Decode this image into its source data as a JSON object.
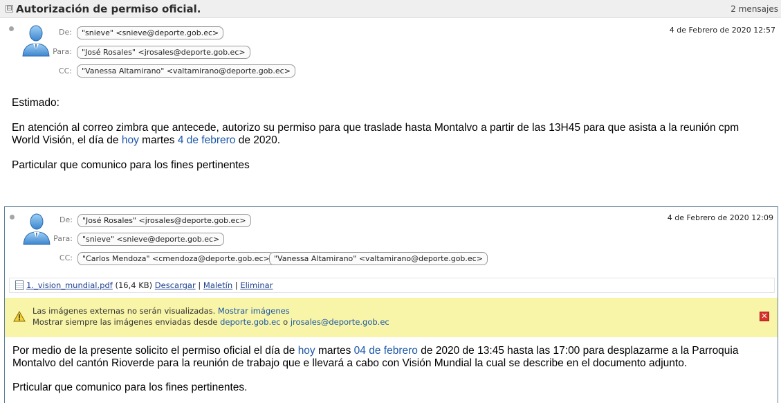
{
  "thread": {
    "title": "Autorización de permiso oficial.",
    "count": "2 mensajes",
    "collapse_glyph": "⊟"
  },
  "messages": [
    {
      "labels": {
        "from": "De:",
        "to": "Para:",
        "cc": "CC:"
      },
      "from": "\"snieve\" <snieve@deporte.gob.ec>",
      "to": "\"José Rosales\" <jrosales@deporte.gob.ec>",
      "cc": [
        "\"Vanessa Altamirano\" <valtamirano@deporte.gob.ec>"
      ],
      "date": "4 de Febrero de 2020 12:57",
      "body": {
        "p1": "Estimado:",
        "p2_a": "En atención al correo zimbra que antecede, autorizo su permiso para que traslade hasta Montalvo a partir de las 13H45 para que asista a la reunión cpm",
        "p2_b": "World Visión, el día de ",
        "p2_link1": "hoy",
        "p2_c": " martes ",
        "p2_link2": "4 de febrero",
        "p2_d": " de 2020.",
        "p3": "Particular que comunico para los fines pertinentes"
      }
    },
    {
      "labels": {
        "from": "De:",
        "to": "Para:",
        "cc": "CC:"
      },
      "from": "\"José Rosales\" <jrosales@deporte.gob.ec>",
      "to": "\"snieve\" <snieve@deporte.gob.ec>",
      "cc": [
        "\"Carlos Mendoza\" <cmendoza@deporte.gob.ec>",
        "\"Vanessa Altamirano\" <valtamirano@deporte.gob.ec>"
      ],
      "date": "4 de Febrero de 2020 12:09",
      "attachment": {
        "name": "1._vision_mundial.pdf",
        "size": "(16,4 KB)",
        "download": "Descargar",
        "briefcase": "Maletín",
        "delete": "Eliminar",
        "sep": "|"
      },
      "warning": {
        "line1": "Las imágenes externas no serán visualizadas.",
        "show_images": "Mostrar imágenes",
        "line2": "Mostrar siempre las imágenes enviadas desde",
        "domain": "deporte.gob.ec",
        "or": "o",
        "sender": "jrosales@deporte.gob.ec",
        "close_glyph": "✕"
      },
      "body": {
        "p1_a": "Por medio de la presente solicito el permiso oficial el día de ",
        "p1_link1": "hoy",
        "p1_b": " martes ",
        "p1_link2": "04 de febrero",
        "p1_c": " de 2020 de 13:45 hasta las 17:00 para desplazarme a la Parroquia",
        "p1_d": "Montalvo del cantón Rioverde para la reunión de trabajo que e llevará a cabo con Visión Mundial la cual se describe en el documento adjunto.",
        "p2": "Prticular que comunico para los fines pertinentes."
      }
    }
  ],
  "icons": {
    "avatar": "user-avatar-icon",
    "unread_dot": "read-status-dot",
    "attachment": "document-icon",
    "warning": "warning-icon",
    "close": "close-icon"
  },
  "colors": {
    "link": "#1a56a8",
    "warning_bg": "#f8f5a8",
    "close_red": "#d9312b",
    "header_bg": "#efefef"
  }
}
